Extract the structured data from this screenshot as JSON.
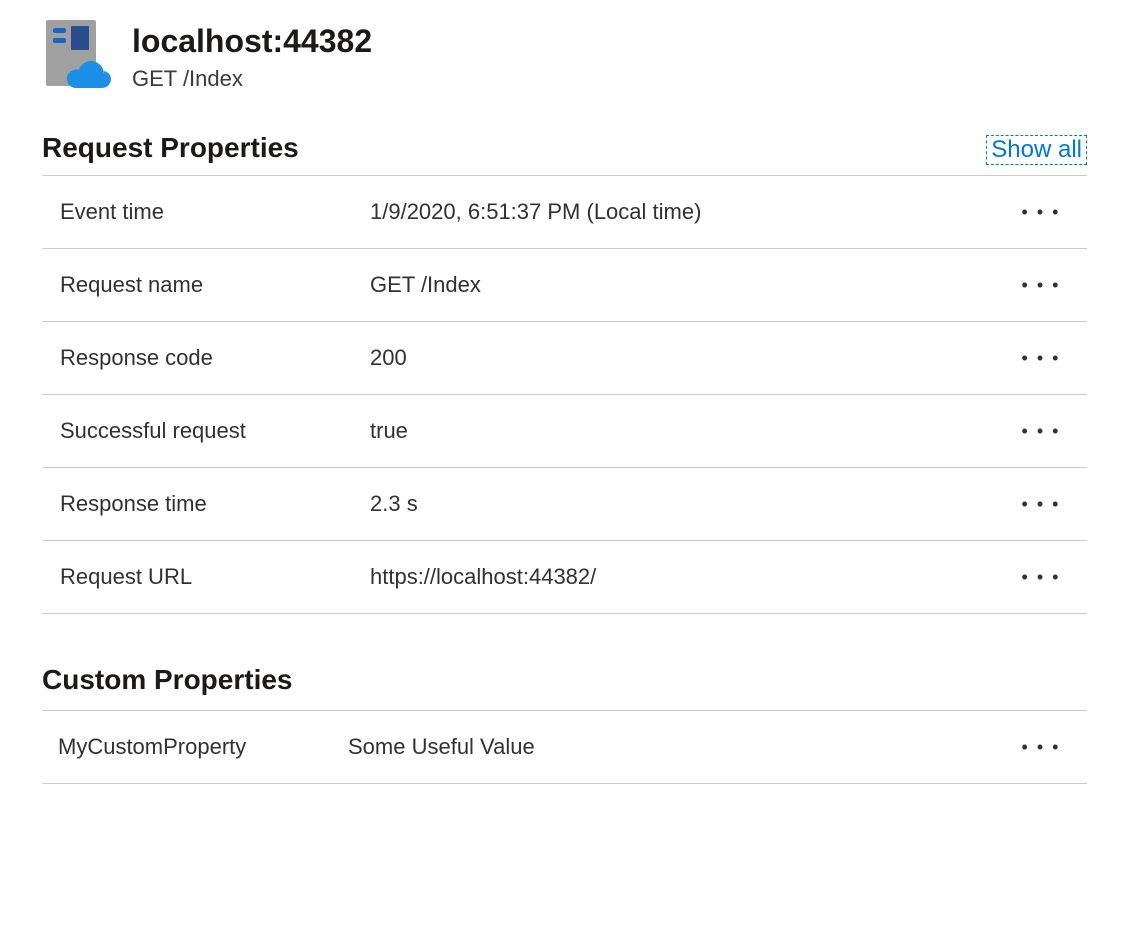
{
  "header": {
    "title": "localhost:44382",
    "subtitle": "GET /Index"
  },
  "request_properties": {
    "title": "Request Properties",
    "show_all_label": "Show all",
    "rows": [
      {
        "label": "Event time",
        "value": "1/9/2020, 6:51:37 PM (Local time)"
      },
      {
        "label": "Request name",
        "value": "GET /Index"
      },
      {
        "label": "Response code",
        "value": "200"
      },
      {
        "label": "Successful request",
        "value": "true"
      },
      {
        "label": "Response time",
        "value": "2.3 s"
      },
      {
        "label": "Request URL",
        "value": "https://localhost:44382/"
      }
    ]
  },
  "custom_properties": {
    "title": "Custom Properties",
    "rows": [
      {
        "label": "MyCustomProperty",
        "value": "Some Useful Value"
      }
    ]
  },
  "icons": {
    "more": "• • •"
  }
}
